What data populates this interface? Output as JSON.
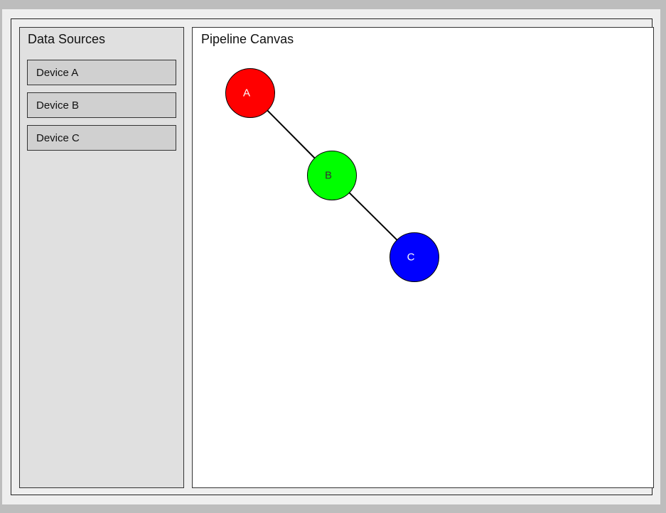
{
  "sidebar": {
    "title": "Data Sources",
    "items": [
      {
        "label": "Device A"
      },
      {
        "label": "Device B"
      },
      {
        "label": "Device C"
      }
    ]
  },
  "canvas": {
    "title": "Pipeline Canvas",
    "nodes": [
      {
        "id": "a",
        "label": "A",
        "color": "#ff0000",
        "text_color": "#ffffff"
      },
      {
        "id": "b",
        "label": "B",
        "color": "#00ff00",
        "text_color": "#333333"
      },
      {
        "id": "c",
        "label": "C",
        "color": "#0000ff",
        "text_color": "#ffffff"
      }
    ],
    "links": [
      {
        "from": "a",
        "to": "b"
      },
      {
        "from": "b",
        "to": "c"
      }
    ]
  }
}
